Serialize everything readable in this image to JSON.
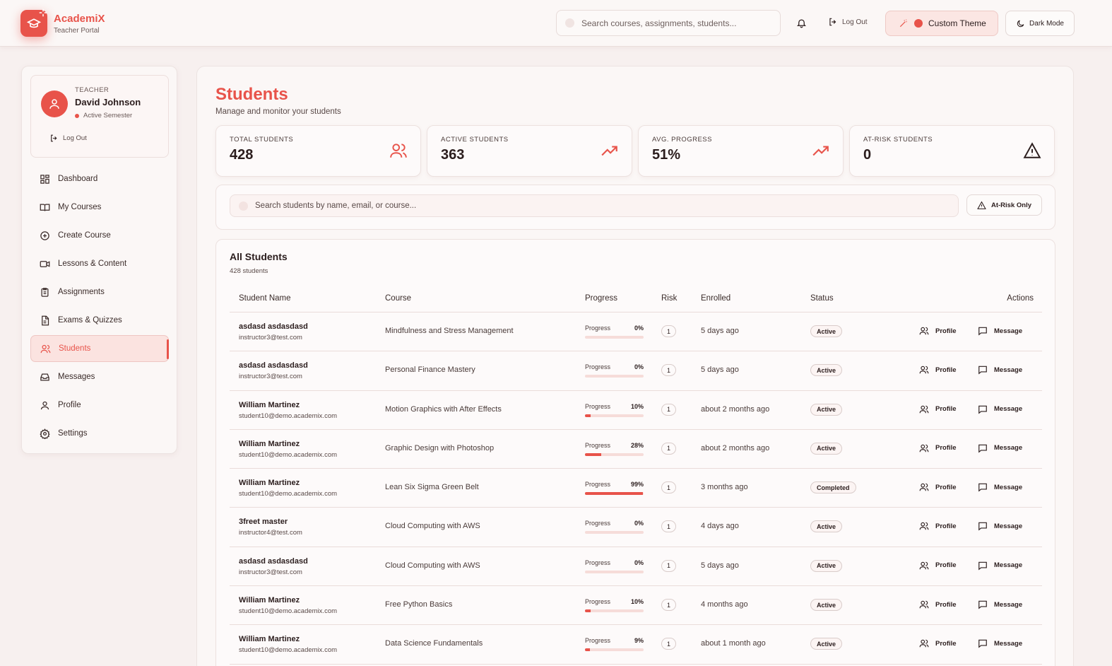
{
  "brand": {
    "name": "AcademiX",
    "subtitle": "Teacher Portal"
  },
  "header": {
    "search_placeholder": "Search courses, assignments, students...",
    "logout_label": "Log Out",
    "theme_label": "Custom Theme",
    "dark_label": "Dark Mode"
  },
  "colors": {
    "accent": "#e8534a",
    "background": "#f7f0ef"
  },
  "user": {
    "role": "TEACHER",
    "name": "David Johnson",
    "semester": "Active Semester",
    "logout_label": "Log Out"
  },
  "nav": [
    {
      "label": "Dashboard",
      "icon": "grid-icon"
    },
    {
      "label": "My Courses",
      "icon": "book-icon"
    },
    {
      "label": "Create Course",
      "icon": "plus-circle-icon"
    },
    {
      "label": "Lessons & Content",
      "icon": "video-icon"
    },
    {
      "label": "Assignments",
      "icon": "clipboard-icon"
    },
    {
      "label": "Exams & Quizzes",
      "icon": "document-icon"
    },
    {
      "label": "Students",
      "icon": "users-icon",
      "active": true
    },
    {
      "label": "Messages",
      "icon": "inbox-icon"
    },
    {
      "label": "Profile",
      "icon": "user-icon"
    },
    {
      "label": "Settings",
      "icon": "gear-icon"
    }
  ],
  "page": {
    "title": "Students",
    "subtitle": "Manage and monitor your students"
  },
  "stats": [
    {
      "label": "TOTAL STUDENTS",
      "value": "428",
      "icon": "users-icon"
    },
    {
      "label": "ACTIVE STUDENTS",
      "value": "363",
      "icon": "trending-up-icon"
    },
    {
      "label": "AVG. PROGRESS",
      "value": "51%",
      "icon": "trending-up-icon"
    },
    {
      "label": "AT-RISK STUDENTS",
      "value": "0",
      "icon": "warning-icon"
    }
  ],
  "filter": {
    "search_placeholder": "Search students by name, email, or course...",
    "at_risk_label": "At-Risk Only"
  },
  "table": {
    "title": "All Students",
    "count": "428 students",
    "columns": [
      "Student Name",
      "Course",
      "Progress",
      "Risk",
      "Enrolled",
      "Status",
      "Actions"
    ],
    "progress_label": "Progress",
    "profile_label": "Profile",
    "message_label": "Message",
    "rows": [
      {
        "name": "asdasd asdasdasd",
        "email": "instructor3@test.com",
        "course": "Mindfulness and Stress Management",
        "progress": 0,
        "progress_text": "0%",
        "risk": "1",
        "enrolled": "5 days ago",
        "status": "Active"
      },
      {
        "name": "asdasd asdasdasd",
        "email": "instructor3@test.com",
        "course": "Personal Finance Mastery",
        "progress": 0,
        "progress_text": "0%",
        "risk": "1",
        "enrolled": "5 days ago",
        "status": "Active"
      },
      {
        "name": "William Martinez",
        "email": "student10@demo.academix.com",
        "course": "Motion Graphics with After Effects",
        "progress": 10,
        "progress_text": "10%",
        "risk": "1",
        "enrolled": "about 2 months ago",
        "status": "Active"
      },
      {
        "name": "William Martinez",
        "email": "student10@demo.academix.com",
        "course": "Graphic Design with Photoshop",
        "progress": 28,
        "progress_text": "28%",
        "risk": "1",
        "enrolled": "about 2 months ago",
        "status": "Active"
      },
      {
        "name": "William Martinez",
        "email": "student10@demo.academix.com",
        "course": "Lean Six Sigma Green Belt",
        "progress": 99,
        "progress_text": "99%",
        "risk": "1",
        "enrolled": "3 months ago",
        "status": "Completed"
      },
      {
        "name": "3freet master",
        "email": "instructor4@test.com",
        "course": "Cloud Computing with AWS",
        "progress": 0,
        "progress_text": "0%",
        "risk": "1",
        "enrolled": "4 days ago",
        "status": "Active"
      },
      {
        "name": "asdasd asdasdasd",
        "email": "instructor3@test.com",
        "course": "Cloud Computing with AWS",
        "progress": 0,
        "progress_text": "0%",
        "risk": "1",
        "enrolled": "5 days ago",
        "status": "Active"
      },
      {
        "name": "William Martinez",
        "email": "student10@demo.academix.com",
        "course": "Free Python Basics",
        "progress": 10,
        "progress_text": "10%",
        "risk": "1",
        "enrolled": "4 months ago",
        "status": "Active"
      },
      {
        "name": "William Martinez",
        "email": "student10@demo.academix.com",
        "course": "Data Science Fundamentals",
        "progress": 9,
        "progress_text": "9%",
        "risk": "1",
        "enrolled": "about 1 month ago",
        "status": "Active"
      }
    ]
  }
}
